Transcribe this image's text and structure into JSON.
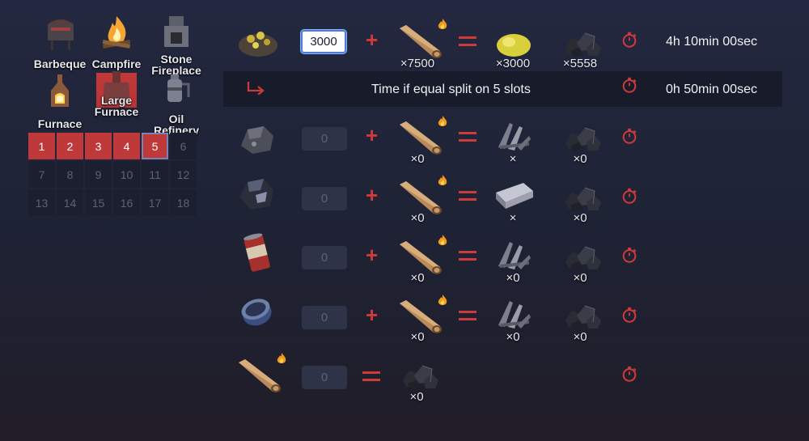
{
  "devices": [
    {
      "name": "Barbeque",
      "label": "Barbeque"
    },
    {
      "name": "Campfire",
      "label": "Campfire"
    },
    {
      "name": "Stone Fireplace",
      "label_line1": "Stone",
      "label_line2": "Fireplace"
    },
    {
      "name": "Furnace",
      "label": "Furnace"
    },
    {
      "name": "Large Furnace",
      "label_line1": "Large",
      "label_line2": "Furnace",
      "selected": true
    },
    {
      "name": "Oil Refinery",
      "label_line1": "Oil",
      "label_line2": "Refinery"
    }
  ],
  "slots": [
    "1",
    "2",
    "3",
    "4",
    "5",
    "6",
    "7",
    "8",
    "9",
    "10",
    "11",
    "12",
    "13",
    "14",
    "15",
    "16",
    "17",
    "18"
  ],
  "active_slots": 5,
  "rows": {
    "gold": {
      "input": "3000",
      "fuel_count": "×7500",
      "output_count": "×3000",
      "charcoal_count": "×5558",
      "time": "4h 10min 00sec"
    },
    "split": {
      "label": "Time if equal split on 5 slots",
      "time": "0h 50min 00sec"
    },
    "metal": {
      "input": "0",
      "fuel_count": "×0",
      "output_count": "×",
      "charcoal_count": "×0"
    },
    "hqm": {
      "input": "0",
      "fuel_count": "×0",
      "output_count": "×",
      "charcoal_count": "×0"
    },
    "can_beans": {
      "input": "0",
      "fuel_count": "×0",
      "output_count": "×0",
      "charcoal_count": "×0"
    },
    "can_tuna": {
      "input": "0",
      "fuel_count": "×0",
      "output_count": "×0",
      "charcoal_count": "×0"
    },
    "wood": {
      "input": "0",
      "charcoal_count": "×0"
    }
  },
  "colors": {
    "accent": "#c0393a",
    "operator": "#cf3a3a",
    "input_focus": "#4f7ad8"
  }
}
